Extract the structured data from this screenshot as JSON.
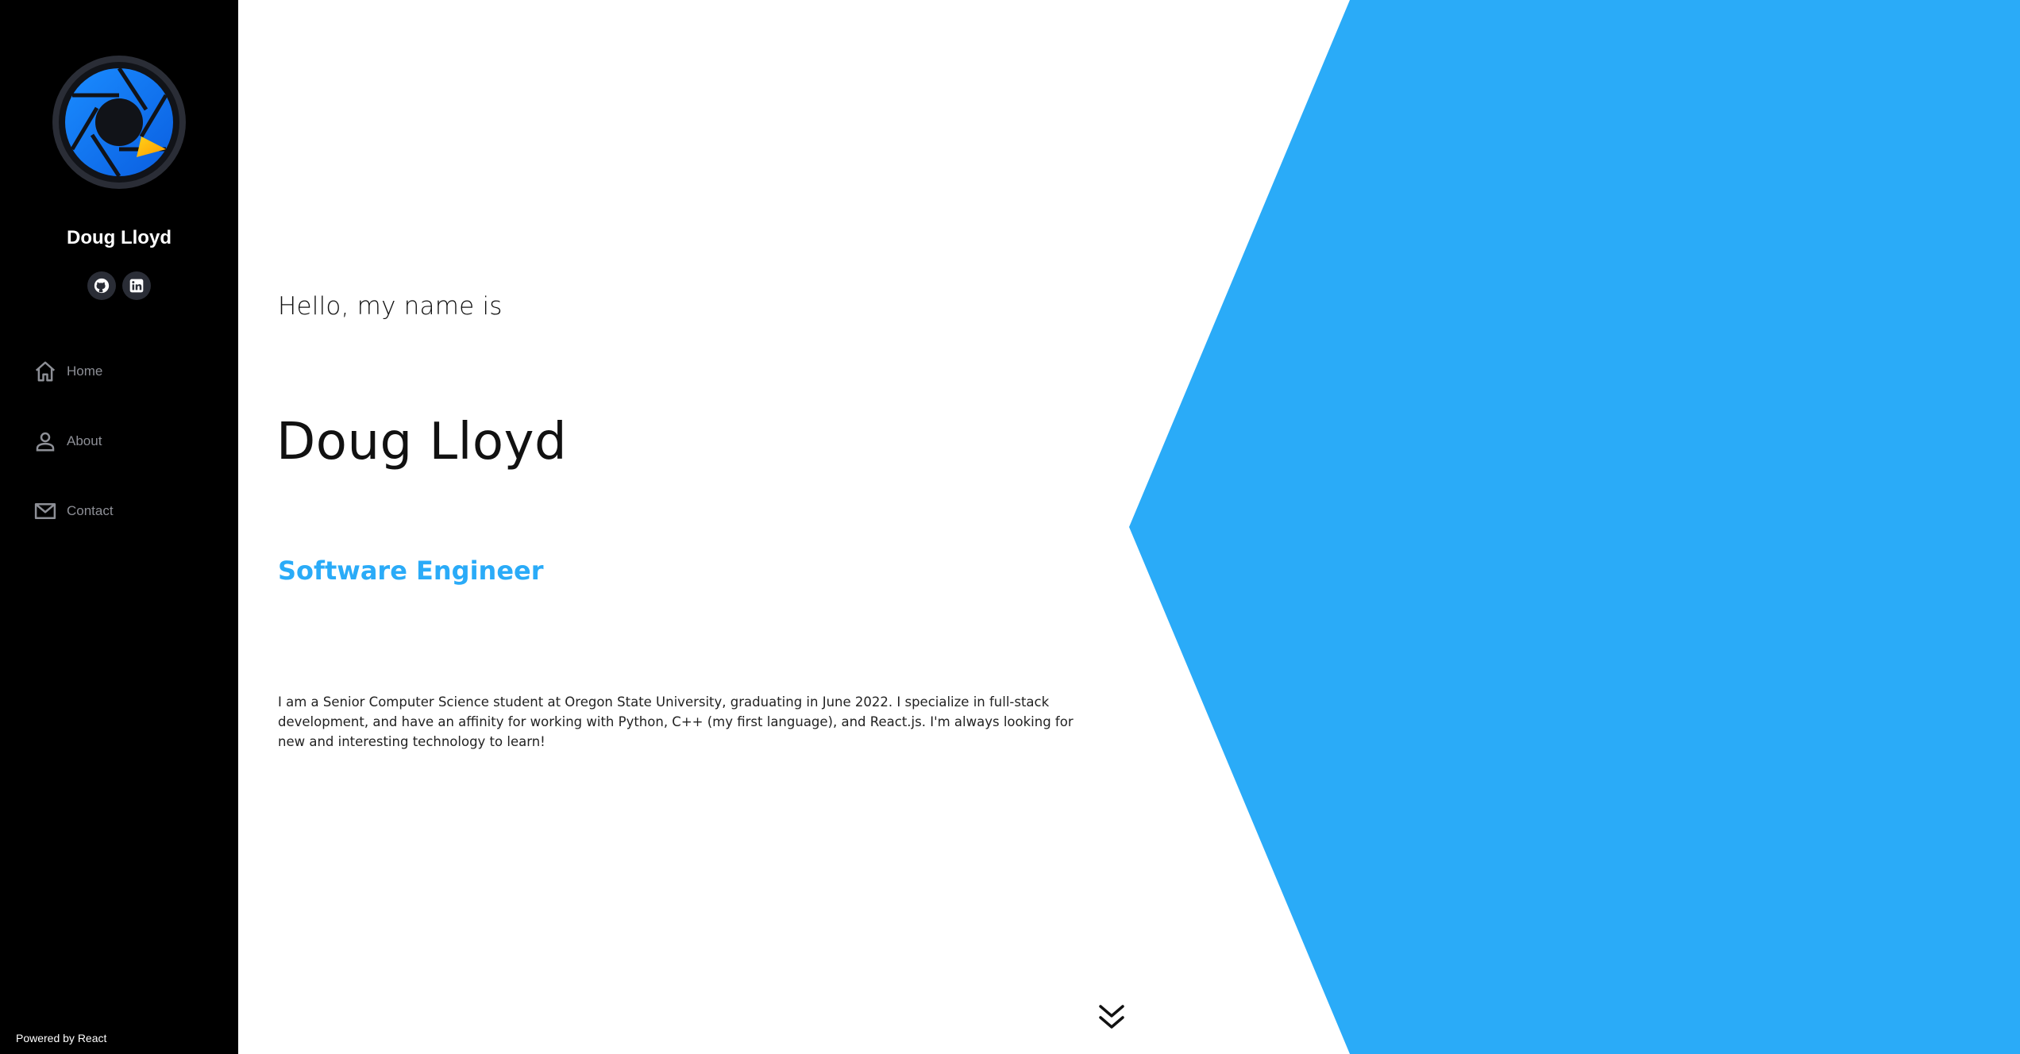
{
  "sidebar": {
    "name": "Doug Lloyd",
    "logo_icon": "aperture-logo-icon",
    "social": [
      {
        "icon": "github-icon"
      },
      {
        "icon": "linkedin-icon"
      }
    ],
    "nav": [
      {
        "label": "Home",
        "icon": "home-icon"
      },
      {
        "label": "About",
        "icon": "person-icon"
      },
      {
        "label": "Contact",
        "icon": "mail-icon"
      }
    ],
    "footer": "Powered by React"
  },
  "main": {
    "greeting": "Hello, my name is",
    "name": "Doug Lloyd",
    "role": "Software Engineer",
    "bio": "I am a Senior Computer Science student at Oregon State University, graduating in June 2022. I specialize in full-stack development, and have an affinity for working with Python, C++ (my first language), and React.js. I'm always looking for new and interesting technology to learn!",
    "scroll_icon": "double-chevron-down-icon"
  },
  "colors": {
    "sidebar_bg": "#000000",
    "accent": "#2aabf8",
    "nav_text": "#8d8f96"
  }
}
